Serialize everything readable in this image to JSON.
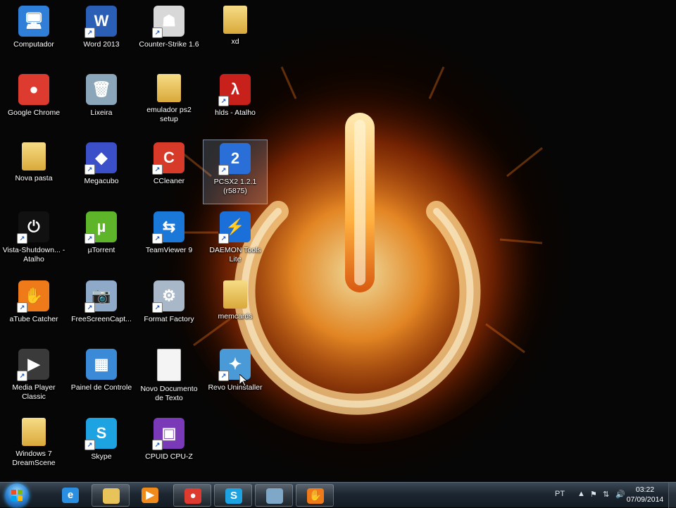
{
  "desktop": {
    "icons": [
      {
        "label": "Computador",
        "icon": "computer-icon",
        "color": "#2f7fd8",
        "glyph": "🖥"
      },
      {
        "label": "Google Chrome",
        "icon": "chrome-icon",
        "color": "#dd3b2f",
        "glyph": "●"
      },
      {
        "label": "Nova pasta",
        "icon": "folder-icon",
        "color": "#e8c35a",
        "glyph": ""
      },
      {
        "label": "Vista-Shutdown... - Atalho",
        "icon": "power-icon",
        "color": "#111111",
        "glyph": "⏻"
      },
      {
        "label": "aTube Catcher",
        "icon": "atube-icon",
        "color": "#ee7a1a",
        "glyph": "✋"
      },
      {
        "label": "Media Player Classic",
        "icon": "media-player-icon",
        "color": "#3a3a3a",
        "glyph": "▶"
      },
      {
        "label": "Windows 7 DreamScene",
        "icon": "folder-icon",
        "color": "#e8c35a",
        "glyph": ""
      },
      {
        "label": "Word 2013",
        "icon": "word-icon",
        "color": "#2a5fb5",
        "glyph": "W"
      },
      {
        "label": "Lixeira",
        "icon": "recycle-bin-icon",
        "color": "#8aa6b8",
        "glyph": "🗑"
      },
      {
        "label": "Megacubo",
        "icon": "megacubo-icon",
        "color": "#3a4fc8",
        "glyph": "◆"
      },
      {
        "label": "µTorrent",
        "icon": "utorrent-icon",
        "color": "#5fb52a",
        "glyph": "µ"
      },
      {
        "label": "FreeScreenCapt...",
        "icon": "camera-icon",
        "color": "#8fa9c8",
        "glyph": "📷"
      },
      {
        "label": "Painel de Controle",
        "icon": "control-panel-icon",
        "color": "#3a8ad8",
        "glyph": "▦"
      },
      {
        "label": "Skype",
        "icon": "skype-icon",
        "color": "#1ea3e2",
        "glyph": "S"
      },
      {
        "label": "Counter-Strike 1.6",
        "icon": "counter-strike-icon",
        "color": "#d8d8d8",
        "glyph": "☗"
      },
      {
        "label": "emulador ps2 setup",
        "icon": "folder-icon",
        "color": "#e8c35a",
        "glyph": ""
      },
      {
        "label": "CCleaner",
        "icon": "ccleaner-icon",
        "color": "#d83a2a",
        "glyph": "C"
      },
      {
        "label": "TeamViewer 9",
        "icon": "teamviewer-icon",
        "color": "#1a78d8",
        "glyph": "⇆"
      },
      {
        "label": "Format Factory",
        "icon": "format-factory-icon",
        "color": "#a8b8c8",
        "glyph": "⚙"
      },
      {
        "label": "Novo Documento de Texto",
        "icon": "text-document-icon",
        "color": "#f4f4f4",
        "glyph": ""
      },
      {
        "label": "CPUID CPU-Z",
        "icon": "cpuz-icon",
        "color": "#7a3ab8",
        "glyph": "▣"
      },
      {
        "label": "xd",
        "icon": "folder-icon",
        "color": "#e8c35a",
        "glyph": ""
      },
      {
        "label": "hlds - Atalho",
        "icon": "half-life-icon",
        "color": "#c8201a",
        "glyph": "λ"
      },
      {
        "label": "PCSX2 1.2.1 (r5875)",
        "icon": "pcsx2-icon",
        "color": "#2a6fd8",
        "glyph": "2"
      },
      {
        "label": "DAEMON Tools Lite",
        "icon": "daemon-tools-icon",
        "color": "#1a6fd8",
        "glyph": "⚡"
      },
      {
        "label": "memcards",
        "icon": "folder-icon",
        "color": "#e8c35a",
        "glyph": ""
      },
      {
        "label": "Revo Uninstaller",
        "icon": "revo-uninstaller-icon",
        "color": "#4a9ad8",
        "glyph": "✦"
      }
    ]
  },
  "taskbar": {
    "start_icon": "windows-start-icon",
    "items": [
      {
        "name": "internet-explorer-icon",
        "glyph": "e",
        "color": "#2a8fe0",
        "pinned": false
      },
      {
        "name": "file-explorer-icon",
        "glyph": "",
        "color": "#e8c35a",
        "pinned": true
      },
      {
        "name": "media-player-icon",
        "glyph": "▶",
        "color": "#f08a1a",
        "pinned": false
      },
      {
        "name": "chrome-icon",
        "glyph": "●",
        "color": "#dd3b2f",
        "pinned": true
      },
      {
        "name": "skype-icon",
        "glyph": "S",
        "color": "#1ea3e2",
        "pinned": true
      },
      {
        "name": "window-icon",
        "glyph": "",
        "color": "#7fa8c8",
        "pinned": true
      },
      {
        "name": "atube-icon",
        "glyph": "✋",
        "color": "#ee7a1a",
        "pinned": true
      }
    ],
    "tray": {
      "language": "PT",
      "time": "03:22",
      "date": "07/09/2014"
    }
  },
  "colors": {
    "taskbar": "#1d2731",
    "fire": "#ff9a2a",
    "label_text": "#ffffff"
  }
}
